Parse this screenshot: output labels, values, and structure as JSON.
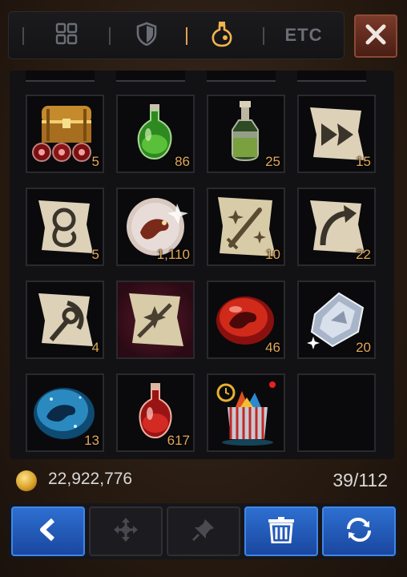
{
  "tabs": [
    {
      "icon": "grid-icon",
      "active": false
    },
    {
      "icon": "shield-icon",
      "active": false
    },
    {
      "icon": "potion-icon",
      "active": true
    },
    {
      "label": "ETC",
      "active": false
    }
  ],
  "close_icon": "close-icon",
  "inventory": {
    "slots": [
      {
        "icon": "treasure-chest-icon",
        "qty": "5"
      },
      {
        "icon": "green-potion-icon",
        "qty": "86"
      },
      {
        "icon": "elixir-bottle-icon",
        "qty": "25"
      },
      {
        "icon": "scroll-arrow-icon",
        "qty": "15"
      },
      {
        "icon": "scroll-swirl-icon",
        "qty": "5"
      },
      {
        "icon": "dragon-orb-icon",
        "qty": "1,110"
      },
      {
        "icon": "scroll-sword-icon",
        "qty": "10"
      },
      {
        "icon": "scroll-curve-icon",
        "qty": "22"
      },
      {
        "icon": "scroll-bow-icon",
        "qty": "4"
      },
      {
        "icon": "scroll-blade-icon",
        "qty": ""
      },
      {
        "icon": "red-dragon-stone-icon",
        "qty": "46"
      },
      {
        "icon": "crystal-gem-icon",
        "qty": "20"
      },
      {
        "icon": "blue-dragon-stone-icon",
        "qty": "13"
      },
      {
        "icon": "red-potion-icon",
        "qty": "617"
      },
      {
        "icon": "gift-bag-icon",
        "qty": ""
      },
      {
        "icon": "",
        "qty": ""
      }
    ]
  },
  "footer": {
    "gold_icon": "gold-coin-icon",
    "gold": "22,922,776",
    "capacity": "39/112"
  },
  "buttons": [
    {
      "icon": "back-arrow-icon",
      "style": "blue"
    },
    {
      "icon": "move-icon",
      "style": "dark"
    },
    {
      "icon": "pin-icon",
      "style": "dark"
    },
    {
      "icon": "trash-icon",
      "style": "blue"
    },
    {
      "icon": "refresh-icon",
      "style": "blue"
    }
  ],
  "colors": {
    "accent_gold": "#e2a85a",
    "button_blue": "#2e6fd0",
    "close_red": "#7a3a2a"
  }
}
